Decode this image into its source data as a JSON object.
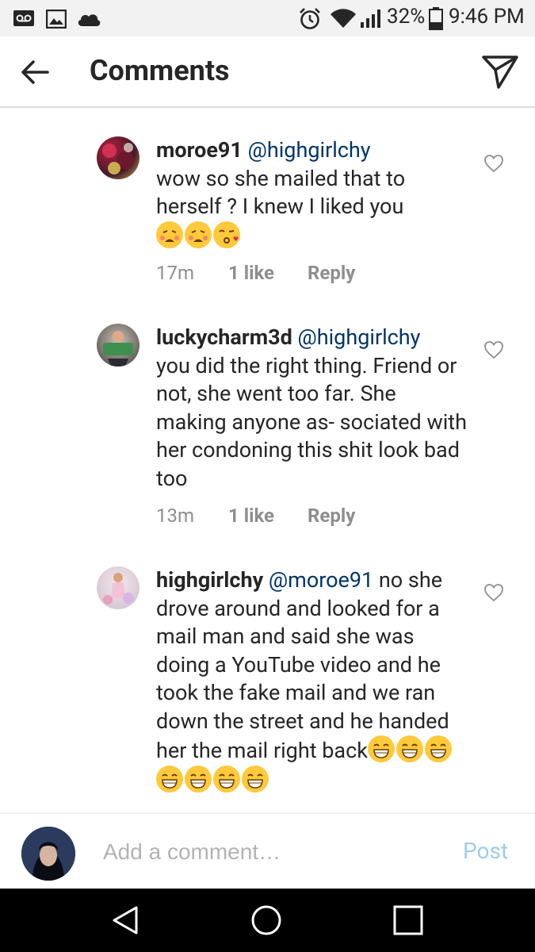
{
  "status_bar": {
    "battery_pct": "32%",
    "time": "9:46 PM",
    "icons": [
      "voicemail-icon",
      "image-icon",
      "cloud-icon",
      "alarm-icon",
      "wifi-icon",
      "signal-icon",
      "battery-icon"
    ]
  },
  "header": {
    "title": "Comments",
    "icons": [
      "back-arrow-icon",
      "send-icon"
    ]
  },
  "comments": [
    {
      "username": "moroe91",
      "mention": "@highgirlchy",
      "text_before": "",
      "text": "wow so she mailed that to herself ? I knew I liked you",
      "emojis": [
        "tired-face-emoji",
        "tired-face-emoji",
        "kissing-face-emoji"
      ],
      "time": "17m",
      "likes": "1 like",
      "reply": "Reply"
    },
    {
      "username": "luckycharm3d",
      "mention": "@highgirlchy",
      "text": "you did the right thing. Friend or not, she went too far. She making anyone as- sociated with her condoning this shit look bad too",
      "emojis": [],
      "time": "13m",
      "likes": "1 like",
      "reply": "Reply"
    },
    {
      "username": "highgirlchy",
      "mention": "@moroe91",
      "text": "no she drove around and looked for a mail man and said she was doing a YouTube video and he took the fake mail and we ran down the street and he handed her the mail right back",
      "emojis": [
        "grinning-face-emoji",
        "grinning-face-emoji",
        "grinning-face-emoji",
        "grinning-face-emoji",
        "grinning-face-emoji",
        "grinning-face-emoji",
        "grinning-face-emoji"
      ]
    }
  ],
  "add_comment": {
    "placeholder": "Add a comment…",
    "post_label": "Post"
  },
  "nav_bar": {
    "icons": [
      "nav-back-icon",
      "nav-home-icon",
      "nav-recents-icon"
    ]
  },
  "colors": {
    "mention": "#003569",
    "meta_gray": "#8e8e8e",
    "post_blue": "#9ecbf1",
    "emoji_yellow": "#ffc93c"
  }
}
